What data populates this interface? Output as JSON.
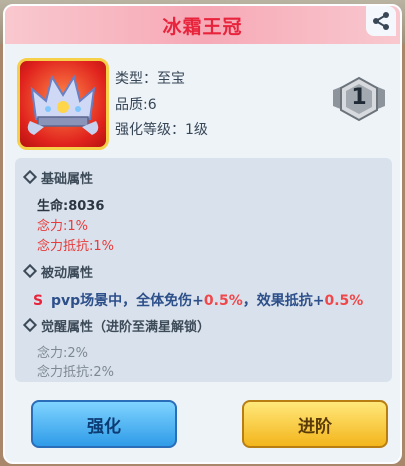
{
  "title": "冰霜王冠",
  "item": {
    "icon": "crown-icon",
    "type_label": "类型：至宝",
    "quality_label": "品质:6",
    "level_label": "强化等级：1级",
    "rank_badge": "1"
  },
  "base": {
    "header": "基础属性",
    "hp": "生命:8036",
    "mind": "念力:1%",
    "mind_resist": "念力抵抗:1%"
  },
  "passive": {
    "header": "被动属性",
    "text_a": "pvp场景中，全体免伤+",
    "value_a": "0.5%",
    "text_b": "，效果抵抗+",
    "value_b": "0.5%"
  },
  "awaken": {
    "header": "觉醒属性（进阶至满星解锁）",
    "mind": "念力:2%",
    "mind_resist": "念力抵抗:2%"
  },
  "buttons": {
    "enhance": "强化",
    "advance": "进阶"
  },
  "colors": {
    "title": "#e8233c",
    "highlight": "#f0474a",
    "blue_button": "#2f9be8",
    "yellow_button": "#f3b51c"
  }
}
